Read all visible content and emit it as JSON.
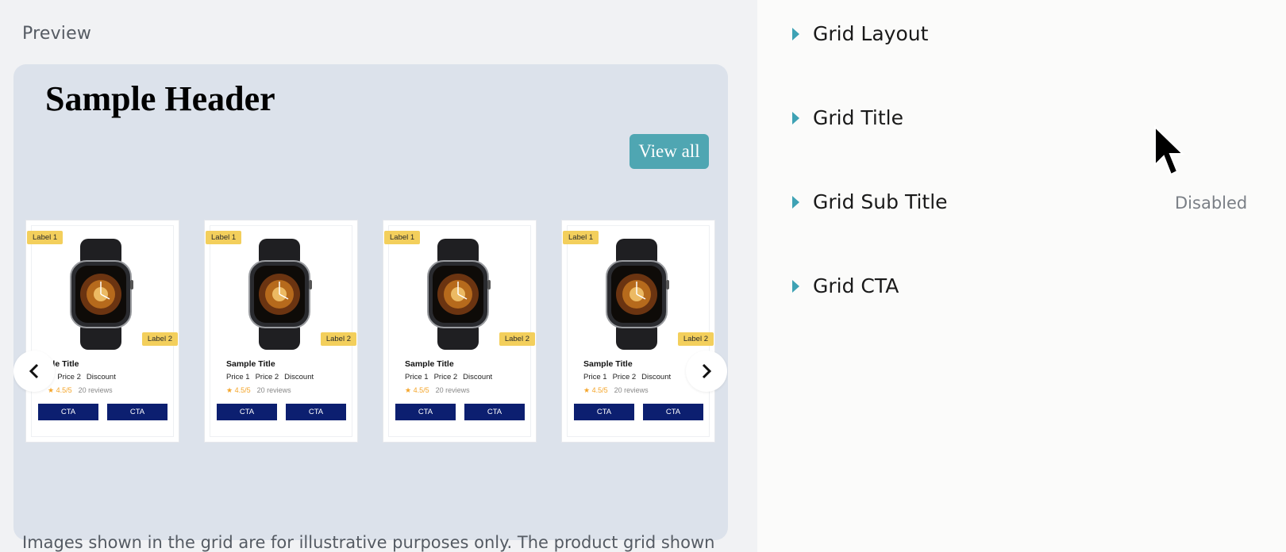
{
  "preview": {
    "label": "Preview",
    "header": "Sample Header",
    "view_all": "View all",
    "disclaimer": "Images shown in the grid are for illustrative purposes only. The product grid shown",
    "cards": [
      {
        "label1": "Label 1",
        "label2": "Label 2",
        "title": "ple Title",
        "price1": "1",
        "price2": "Price 2",
        "discount": "Discount",
        "rating": "4.5/5",
        "reviews": "20 reviews",
        "cta1": "CTA",
        "cta2": "CTA"
      },
      {
        "label1": "Label 1",
        "label2": "Label 2",
        "title": "Sample Title",
        "price1": "Price 1",
        "price2": "Price 2",
        "discount": "Discount",
        "rating": "4.5/5",
        "reviews": "20 reviews",
        "cta1": "CTA",
        "cta2": "CTA"
      },
      {
        "label1": "Label 1",
        "label2": "Label 2",
        "title": "Sample Title",
        "price1": "Price 1",
        "price2": "Price 2",
        "discount": "Discount",
        "rating": "4.5/5",
        "reviews": "20 reviews",
        "cta1": "CTA",
        "cta2": "CTA"
      },
      {
        "label1": "Label 1",
        "label2": "Label 2",
        "title": "Sample Title",
        "price1": "Price 1",
        "price2": "Price 2",
        "discount": "Discount",
        "rating": "4.5/5",
        "reviews": "20 reviews",
        "cta1": "CTA",
        "cta2": "CTA"
      }
    ],
    "icons": {
      "prev": "chevron-left-icon",
      "next": "chevron-right-icon",
      "star": "star-icon"
    }
  },
  "settings": {
    "sections": [
      {
        "title": "Grid Layout",
        "status": ""
      },
      {
        "title": "Grid Title",
        "status": ""
      },
      {
        "title": "Grid Sub Title",
        "status": "Disabled"
      },
      {
        "title": "Grid CTA",
        "status": ""
      }
    ]
  },
  "colors": {
    "accent": "#4fa6b2",
    "cta": "#0c1f70",
    "badge": "#f3cf5c",
    "canvas": "#dce2eb",
    "caret": "#3ea2b4"
  }
}
